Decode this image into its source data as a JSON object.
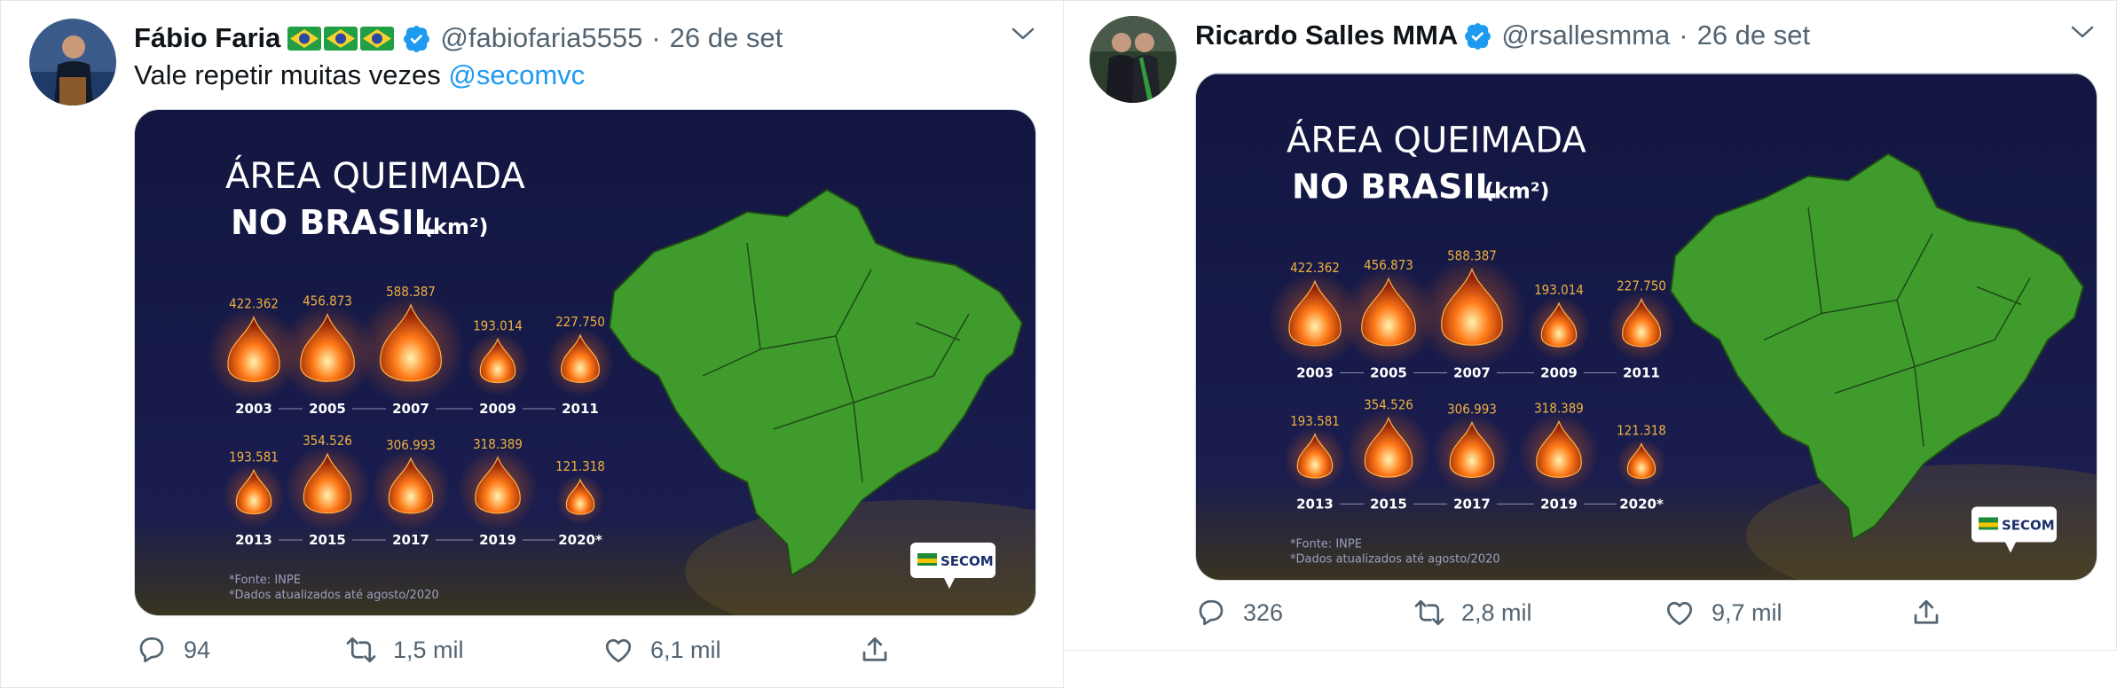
{
  "tweets": [
    {
      "name": "Fábio Faria",
      "flag_emoji": "🇧🇷🇧🇷🇧🇷",
      "verified": true,
      "handle": "@fabiofaria5555",
      "separator": "·",
      "date": "26 de set",
      "text": "Vale repetir muitas vezes",
      "mention": "@secomvc",
      "actions": {
        "replies": "94",
        "retweets": "1,5 mil",
        "likes": "6,1 mil"
      }
    },
    {
      "name": "Ricardo Salles MMA",
      "verified": true,
      "handle": "@rsallesmma",
      "separator": "·",
      "date": "26 de set",
      "actions": {
        "replies": "326",
        "retweets": "2,8 mil",
        "likes": "9,7 mil"
      }
    }
  ],
  "infographic": {
    "title_line1": "ÁREA QUEIMADA",
    "title_line2": "NO BRASIL",
    "unit": "(km²)",
    "chart_data": {
      "type": "bar",
      "title": "ÁREA QUEIMADA NO BRASIL (km²)",
      "categories": [
        "2003",
        "2005",
        "2007",
        "2009",
        "2011",
        "2013",
        "2015",
        "2017",
        "2019",
        "2020*"
      ],
      "values": [
        422362,
        456873,
        588387,
        193014,
        227750,
        193581,
        354526,
        306993,
        318389,
        121318
      ],
      "value_labels": [
        "422.362",
        "456.873",
        "588.387",
        "193.014",
        "227.750",
        "193.581",
        "354.526",
        "306.993",
        "318.389",
        "121.318"
      ]
    },
    "footnote1": "*Fonte: INPE",
    "footnote2": "*Dados atualizados até agosto/2020",
    "logo_text": "SECOM",
    "colors": {
      "background": "#1a1a4a",
      "map": "#3f9b2c",
      "flame": "#ff7a18",
      "value": "#f0b040"
    }
  },
  "icons": [
    "reply-icon",
    "retweet-icon",
    "like-icon",
    "share-icon",
    "verified-icon",
    "caret-down-icon"
  ]
}
